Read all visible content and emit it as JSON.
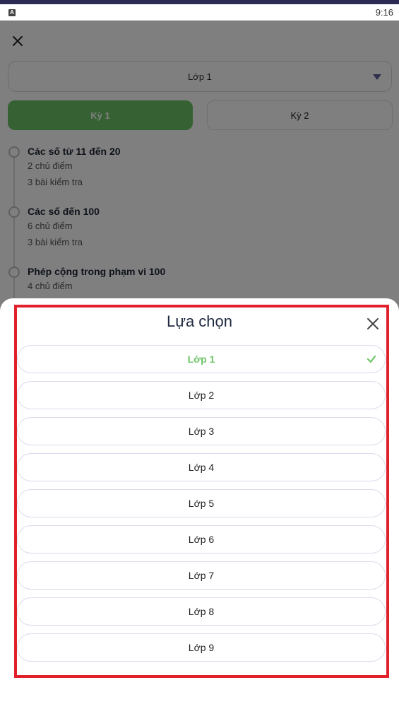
{
  "status_bar": {
    "time": "9:16",
    "app_icon_letter": "A"
  },
  "background": {
    "grade_value": "Lớp 1",
    "terms": [
      {
        "label": "Kỳ 1",
        "active": true
      },
      {
        "label": "Kỳ 2",
        "active": false
      }
    ],
    "topics": [
      {
        "title": "Các số từ 11 đến 20",
        "lines": [
          "2 chủ điểm",
          "3 bài kiểm tra"
        ]
      },
      {
        "title": "Các số đến 100",
        "lines": [
          "6 chủ điểm",
          "3 bài kiểm tra"
        ]
      },
      {
        "title": "Phép cộng trong phạm vi 100",
        "lines": [
          "4 chủ điểm"
        ]
      }
    ]
  },
  "sheet": {
    "title": "Lựa chọn",
    "options": [
      "Lớp 1",
      "Lớp 2",
      "Lớp 3",
      "Lớp 4",
      "Lớp 5",
      "Lớp 6",
      "Lớp 7",
      "Lớp 8",
      "Lớp 9"
    ],
    "selected_index": 0
  },
  "colors": {
    "accent_green": "#6cc567",
    "highlight_red": "#e0202b",
    "caret": "#5a5f9a"
  },
  "icons": {
    "close": "close-icon",
    "dropdown": "chevron-down-icon",
    "check": "check-icon"
  }
}
